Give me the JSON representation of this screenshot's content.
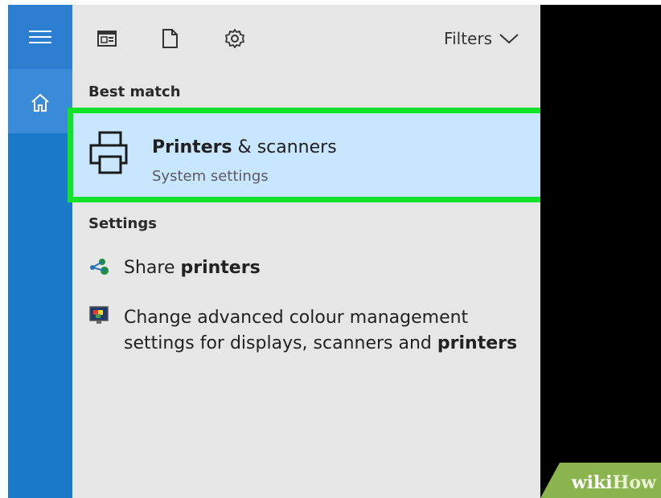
{
  "sidebar": {
    "menu_icon": "hamburger-icon",
    "home_icon": "home-icon"
  },
  "toolbar": {
    "icons": [
      "news-icon",
      "document-icon",
      "gear-icon"
    ],
    "filters_label": "Filters"
  },
  "sections": {
    "best_match_title": "Best match",
    "settings_title": "Settings"
  },
  "best_match": {
    "title_bold": "Printers",
    "title_rest": " & scanners",
    "subtitle": "System settings",
    "icon": "printer-icon"
  },
  "settings_results": [
    {
      "icon": "share-printers-icon",
      "text": "Share ",
      "bold": "printers"
    },
    {
      "icon": "display-color-icon",
      "line1": "Change advanced colour management",
      "line2": "settings for displays, scanners and ",
      "bold": "printers"
    }
  ],
  "watermark": {
    "part1": "wiki",
    "part2": "How"
  },
  "colors": {
    "sidebar": "#1b79c9",
    "panel": "#e6e6e6",
    "highlight": "#c9e6ff",
    "highlight_border": "#11e22a"
  }
}
